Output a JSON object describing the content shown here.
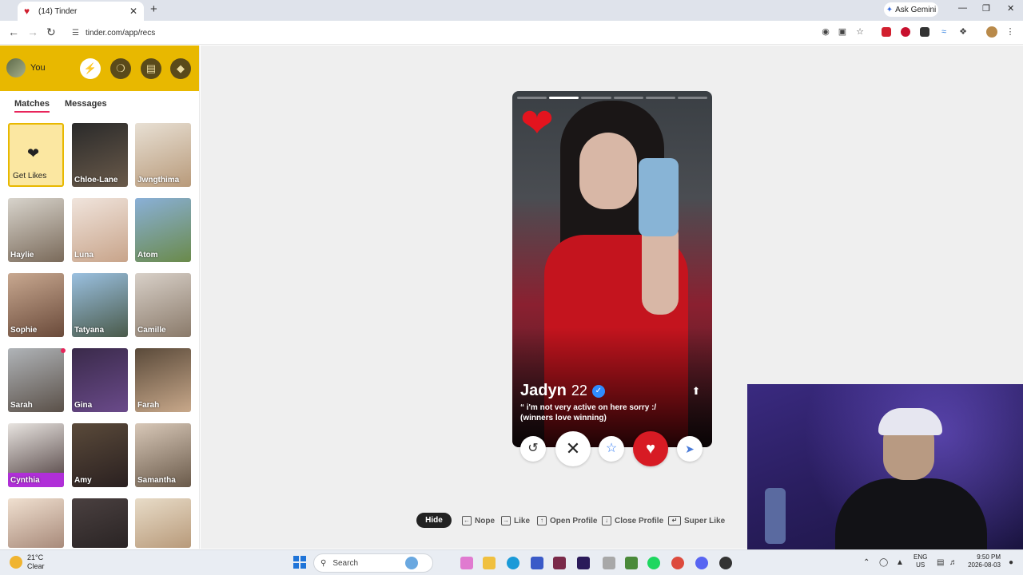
{
  "browser": {
    "tab_title": "(14) Tinder",
    "ask_gemini": "Ask Gemini",
    "url": "tinder.com/app/recs"
  },
  "sidebar": {
    "user_name": "You",
    "tabs": [
      "Matches",
      "Messages"
    ],
    "matches": [
      {
        "name": "Get Likes"
      },
      {
        "name": "Chloe-Lane"
      },
      {
        "name": "Jwngthima"
      },
      {
        "name": "Haylie"
      },
      {
        "name": "Luna"
      },
      {
        "name": "Atom"
      },
      {
        "name": "Sophie"
      },
      {
        "name": "Tatyana"
      },
      {
        "name": "Camille"
      },
      {
        "name": "Sarah"
      },
      {
        "name": "Gina"
      },
      {
        "name": "Farah"
      },
      {
        "name": "Cynthia"
      },
      {
        "name": "Amy"
      },
      {
        "name": "Samantha"
      }
    ]
  },
  "profile": {
    "name": "Jadyn",
    "age": "22",
    "bio_line1": "“ i'm not very active on here sorry :/",
    "bio_line2": "(winners love winning)",
    "photo_count": 6,
    "current_photo": 2
  },
  "shortcuts": {
    "hide": "Hide",
    "nope": "Nope",
    "like": "Like",
    "open_profile": "Open Profile",
    "close_profile": "Close Profile",
    "super_like": "Super Like"
  },
  "taskbar": {
    "temp": "21°C",
    "condition": "Clear",
    "search": "Search",
    "lang1": "ENG",
    "lang2": "US",
    "time": "9:50 PM",
    "date": "2026-08-03"
  },
  "colors": {
    "tinder_yellow": "#e8b800",
    "like_red": "#d71b24",
    "accent_pink": "#e8255b",
    "super_purple": "#b02fd8"
  }
}
